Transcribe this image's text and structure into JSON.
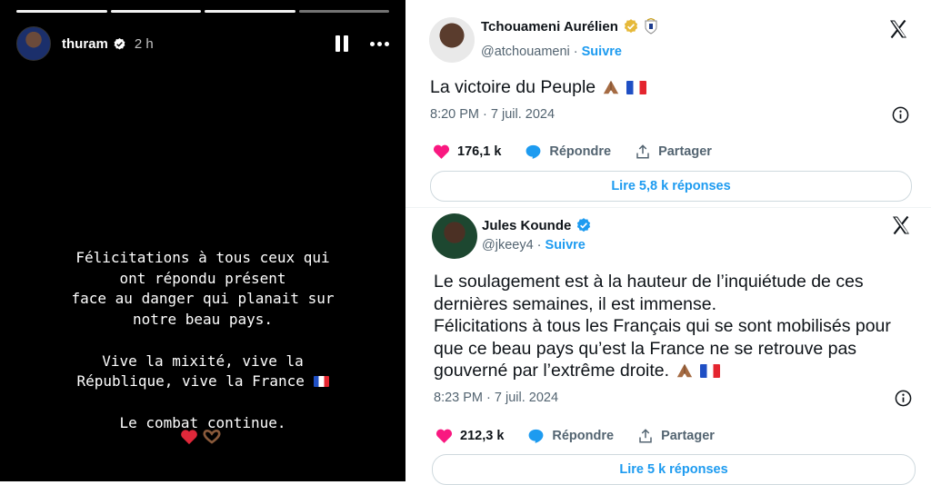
{
  "story": {
    "username": "thuram",
    "time": "2 h",
    "text_lines": [
      "Félicitations à tous ceux qui",
      "ont répondu présent",
      "face au danger qui planait sur",
      "notre beau pays.",
      "",
      "Vive la mixité, vive la",
      "République, vive la France",
      "",
      "Le combat continue."
    ],
    "icons": [
      "verified-icon",
      "pause-icon",
      "more-icon",
      "france-flag-icon",
      "red-heart-icon",
      "heart-hands-icon"
    ]
  },
  "tweets": [
    {
      "name": "Tchouameni Aurélien",
      "handle": "@atchouameni",
      "follow": "Suivre",
      "badge": "club-badge-icon",
      "text": "La victoire du Peuple",
      "date": "8:20 PM · 7 juil. 2024",
      "likes": "176,1 k",
      "reply_label": "Répondre",
      "share_label": "Partager",
      "replies_button": "Lire 5,8 k réponses"
    },
    {
      "name": "Jules Kounde",
      "handle": "@jkeey4",
      "follow": "Suivre",
      "badge": "verified-icon",
      "text_lines": [
        "Le soulagement est à la hauteur de l’inquiétude de ces",
        "dernières semaines, il est immense.",
        "Félicitations à tous les Français qui se sont mobilisés pour",
        "que ce beau pays qu’est la France ne se retrouve pas",
        "gouverné par l’extrême droite."
      ],
      "date": "8:23 PM · 7 juil. 2024",
      "likes": "212,3 k",
      "reply_label": "Répondre",
      "share_label": "Partager",
      "replies_button": "Lire 5 k réponses"
    }
  ],
  "colors": {
    "like": "#f91880",
    "link": "#1d9bf0",
    "muted": "#536471",
    "story_bg": "#000000"
  }
}
